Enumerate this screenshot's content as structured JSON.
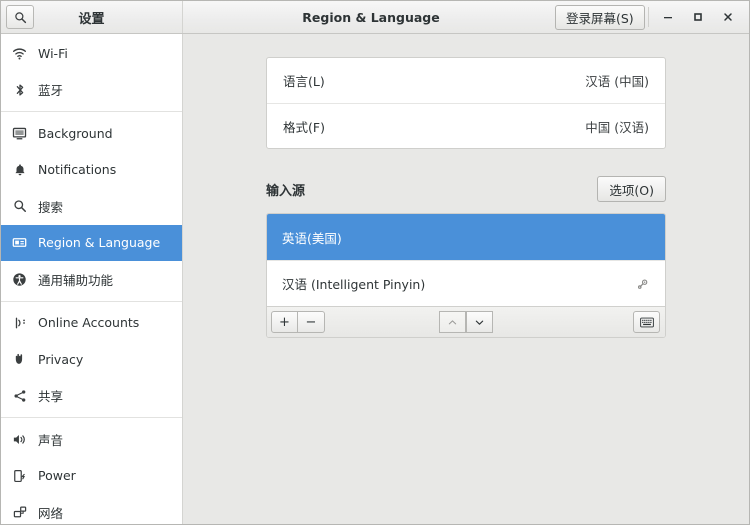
{
  "window": {
    "settings_title": "设置",
    "panel_title": "Region & Language",
    "login_screen_button": "登录屏幕(S)",
    "search_icon": "search-icon",
    "minimize_label": "−",
    "maximize_label": "□",
    "close_label": "×"
  },
  "sidebar": {
    "items": [
      {
        "label": "Wi-Fi",
        "icon": "wifi-icon",
        "selected": false,
        "sep_after": false
      },
      {
        "label": "蓝牙",
        "icon": "bluetooth-icon",
        "selected": false,
        "sep_after": true
      },
      {
        "label": "Background",
        "icon": "background-icon",
        "selected": false,
        "sep_after": false
      },
      {
        "label": "Notifications",
        "icon": "bell-icon",
        "selected": false,
        "sep_after": false
      },
      {
        "label": "搜索",
        "icon": "search-icon",
        "selected": false,
        "sep_after": false
      },
      {
        "label": "Region & Language",
        "icon": "region-language-icon",
        "selected": true,
        "sep_after": false
      },
      {
        "label": "通用辅助功能",
        "icon": "accessibility-icon",
        "selected": false,
        "sep_after": true
      },
      {
        "label": "Online Accounts",
        "icon": "online-accounts-icon",
        "selected": false,
        "sep_after": false
      },
      {
        "label": "Privacy",
        "icon": "privacy-hand-icon",
        "selected": false,
        "sep_after": false
      },
      {
        "label": "共享",
        "icon": "sharing-icon",
        "selected": false,
        "sep_after": true
      },
      {
        "label": "声音",
        "icon": "sound-icon",
        "selected": false,
        "sep_after": false
      },
      {
        "label": "Power",
        "icon": "power-icon",
        "selected": false,
        "sep_after": false
      },
      {
        "label": "网络",
        "icon": "network-icon",
        "selected": false,
        "sep_after": false
      }
    ]
  },
  "main": {
    "language_card": [
      {
        "label": "语言(L)",
        "value": "汉语 (中国)"
      },
      {
        "label": "格式(F)",
        "value": "中国 (汉语)"
      }
    ],
    "input_sources": {
      "heading": "输入源",
      "options_button": "选项(O)",
      "rows": [
        {
          "label": "英语(美国)",
          "selected": true,
          "has_gear": false
        },
        {
          "label": "汉语 (Intelligent Pinyin)",
          "selected": false,
          "has_gear": true
        }
      ],
      "toolbar": {
        "add_label": "+",
        "remove_label": "−",
        "move_up_label": "⌃",
        "move_down_label": "⌄",
        "keyboard_icon": "keyboard-icon"
      }
    }
  },
  "colors": {
    "accent_blue": "#4a90d9",
    "content_bg": "#e8e8e6",
    "card_bg": "#ffffff",
    "text": "#2e3436"
  }
}
